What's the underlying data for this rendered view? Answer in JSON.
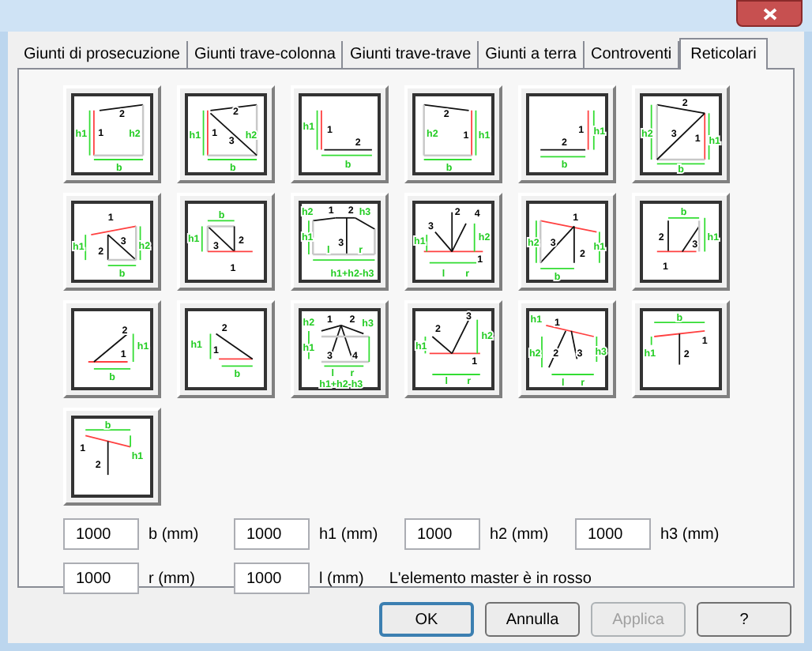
{
  "tabs": [
    {
      "label": "Giunti di prosecuzione",
      "selected": false
    },
    {
      "label": "Giunti trave-colonna",
      "selected": false
    },
    {
      "label": "Giunti trave-trave",
      "selected": false
    },
    {
      "label": "Giunti a terra",
      "selected": false
    },
    {
      "label": "Controventi",
      "selected": false
    },
    {
      "label": "Reticolari",
      "selected": true
    }
  ],
  "diagrams": [
    {
      "labels": [
        {
          "text": "2",
          "kind": "member"
        },
        {
          "text": "h1",
          "kind": "dimension"
        },
        {
          "text": "1",
          "kind": "member"
        },
        {
          "text": "h2",
          "kind": "dimension"
        },
        {
          "text": "b",
          "kind": "dimension"
        }
      ]
    },
    {
      "labels": [
        {
          "text": "2",
          "kind": "member"
        },
        {
          "text": "h1",
          "kind": "dimension"
        },
        {
          "text": "1",
          "kind": "member"
        },
        {
          "text": "h2",
          "kind": "dimension"
        },
        {
          "text": "3",
          "kind": "member"
        },
        {
          "text": "b",
          "kind": "dimension"
        }
      ]
    },
    {
      "labels": [
        {
          "text": "h1",
          "kind": "dimension"
        },
        {
          "text": "1",
          "kind": "member"
        },
        {
          "text": "2",
          "kind": "member"
        },
        {
          "text": "b",
          "kind": "dimension"
        }
      ]
    },
    {
      "labels": [
        {
          "text": "2",
          "kind": "member"
        },
        {
          "text": "h2",
          "kind": "dimension"
        },
        {
          "text": "1",
          "kind": "member"
        },
        {
          "text": "h1",
          "kind": "dimension"
        },
        {
          "text": "b",
          "kind": "dimension"
        }
      ]
    },
    {
      "labels": [
        {
          "text": "1",
          "kind": "member"
        },
        {
          "text": "h1",
          "kind": "dimension"
        },
        {
          "text": "2",
          "kind": "member"
        },
        {
          "text": "b",
          "kind": "dimension"
        }
      ]
    },
    {
      "labels": [
        {
          "text": "2",
          "kind": "member"
        },
        {
          "text": "h2",
          "kind": "dimension"
        },
        {
          "text": "3",
          "kind": "member"
        },
        {
          "text": "1",
          "kind": "member"
        },
        {
          "text": "h1",
          "kind": "dimension"
        },
        {
          "text": "b",
          "kind": "dimension"
        }
      ]
    },
    {
      "labels": [
        {
          "text": "1",
          "kind": "member"
        },
        {
          "text": "h1",
          "kind": "dimension"
        },
        {
          "text": "2",
          "kind": "member"
        },
        {
          "text": "3",
          "kind": "member"
        },
        {
          "text": "h2",
          "kind": "dimension"
        },
        {
          "text": "b",
          "kind": "dimension"
        }
      ]
    },
    {
      "labels": [
        {
          "text": "b",
          "kind": "dimension"
        },
        {
          "text": "h1",
          "kind": "dimension"
        },
        {
          "text": "3",
          "kind": "member"
        },
        {
          "text": "2",
          "kind": "member"
        },
        {
          "text": "1",
          "kind": "member"
        }
      ]
    },
    {
      "labels": [
        {
          "text": "h2",
          "kind": "dimension"
        },
        {
          "text": "1",
          "kind": "member"
        },
        {
          "text": "2",
          "kind": "member"
        },
        {
          "text": "h3",
          "kind": "dimension"
        },
        {
          "text": "h1",
          "kind": "dimension"
        },
        {
          "text": "3",
          "kind": "member"
        },
        {
          "text": "l",
          "kind": "dimension"
        },
        {
          "text": "r",
          "kind": "dimension"
        },
        {
          "text": "h1+h2-h3",
          "kind": "dimension"
        }
      ]
    },
    {
      "labels": [
        {
          "text": "3",
          "kind": "member"
        },
        {
          "text": "2",
          "kind": "member"
        },
        {
          "text": "4",
          "kind": "member"
        },
        {
          "text": "h1",
          "kind": "dimension"
        },
        {
          "text": "h2",
          "kind": "dimension"
        },
        {
          "text": "1",
          "kind": "member"
        },
        {
          "text": "l",
          "kind": "dimension"
        },
        {
          "text": "r",
          "kind": "dimension"
        }
      ]
    },
    {
      "labels": [
        {
          "text": "1",
          "kind": "member"
        },
        {
          "text": "h2",
          "kind": "dimension"
        },
        {
          "text": "3",
          "kind": "member"
        },
        {
          "text": "2",
          "kind": "member"
        },
        {
          "text": "h1",
          "kind": "dimension"
        },
        {
          "text": "b",
          "kind": "dimension"
        }
      ]
    },
    {
      "labels": [
        {
          "text": "b",
          "kind": "dimension"
        },
        {
          "text": "2",
          "kind": "member"
        },
        {
          "text": "3",
          "kind": "member"
        },
        {
          "text": "h1",
          "kind": "dimension"
        },
        {
          "text": "1",
          "kind": "member"
        }
      ]
    },
    {
      "labels": [
        {
          "text": "2",
          "kind": "member"
        },
        {
          "text": "1",
          "kind": "member"
        },
        {
          "text": "h1",
          "kind": "dimension"
        },
        {
          "text": "b",
          "kind": "dimension"
        }
      ]
    },
    {
      "labels": [
        {
          "text": "2",
          "kind": "member"
        },
        {
          "text": "h1",
          "kind": "dimension"
        },
        {
          "text": "1",
          "kind": "member"
        },
        {
          "text": "b",
          "kind": "dimension"
        }
      ]
    },
    {
      "labels": [
        {
          "text": "h2",
          "kind": "dimension"
        },
        {
          "text": "1",
          "kind": "member"
        },
        {
          "text": "2",
          "kind": "member"
        },
        {
          "text": "h3",
          "kind": "dimension"
        },
        {
          "text": "h1",
          "kind": "dimension"
        },
        {
          "text": "3",
          "kind": "member"
        },
        {
          "text": "4",
          "kind": "member"
        },
        {
          "text": "l",
          "kind": "dimension"
        },
        {
          "text": "r",
          "kind": "dimension"
        },
        {
          "text": "h1+h2-h3",
          "kind": "dimension"
        }
      ]
    },
    {
      "labels": [
        {
          "text": "2",
          "kind": "member"
        },
        {
          "text": "3",
          "kind": "member"
        },
        {
          "text": "h1",
          "kind": "dimension"
        },
        {
          "text": "h2",
          "kind": "dimension"
        },
        {
          "text": "1",
          "kind": "member"
        },
        {
          "text": "l",
          "kind": "dimension"
        },
        {
          "text": "r",
          "kind": "dimension"
        }
      ]
    },
    {
      "labels": [
        {
          "text": "h1",
          "kind": "dimension"
        },
        {
          "text": "1",
          "kind": "member"
        },
        {
          "text": "h2",
          "kind": "dimension"
        },
        {
          "text": "2",
          "kind": "member"
        },
        {
          "text": "3",
          "kind": "member"
        },
        {
          "text": "h3",
          "kind": "dimension"
        },
        {
          "text": "l",
          "kind": "dimension"
        },
        {
          "text": "r",
          "kind": "dimension"
        }
      ]
    },
    {
      "labels": [
        {
          "text": "b",
          "kind": "dimension"
        },
        {
          "text": "1",
          "kind": "member"
        },
        {
          "text": "h1",
          "kind": "dimension"
        },
        {
          "text": "2",
          "kind": "member"
        }
      ]
    },
    {
      "labels": [
        {
          "text": "b",
          "kind": "dimension"
        },
        {
          "text": "1",
          "kind": "member"
        },
        {
          "text": "h1",
          "kind": "dimension"
        },
        {
          "text": "2",
          "kind": "member"
        }
      ]
    }
  ],
  "field_rows": [
    [
      {
        "value": "1000",
        "label": "b (mm)"
      },
      {
        "value": "1000",
        "label": "h1 (mm)"
      },
      {
        "value": "1000",
        "label": "h2 (mm)"
      },
      {
        "value": "1000",
        "label": "h3 (mm)"
      }
    ],
    [
      {
        "value": "1000",
        "label": "r (mm)"
      },
      {
        "value": "1000",
        "label": "l (mm)"
      }
    ]
  ],
  "note": "L'elemento master è in rosso",
  "buttons": [
    {
      "label": "OK",
      "disabled": false,
      "default": true
    },
    {
      "label": "Annulla",
      "disabled": false,
      "default": false
    },
    {
      "label": "Applica",
      "disabled": true,
      "default": false
    },
    {
      "label": "?",
      "disabled": false,
      "default": false
    }
  ]
}
